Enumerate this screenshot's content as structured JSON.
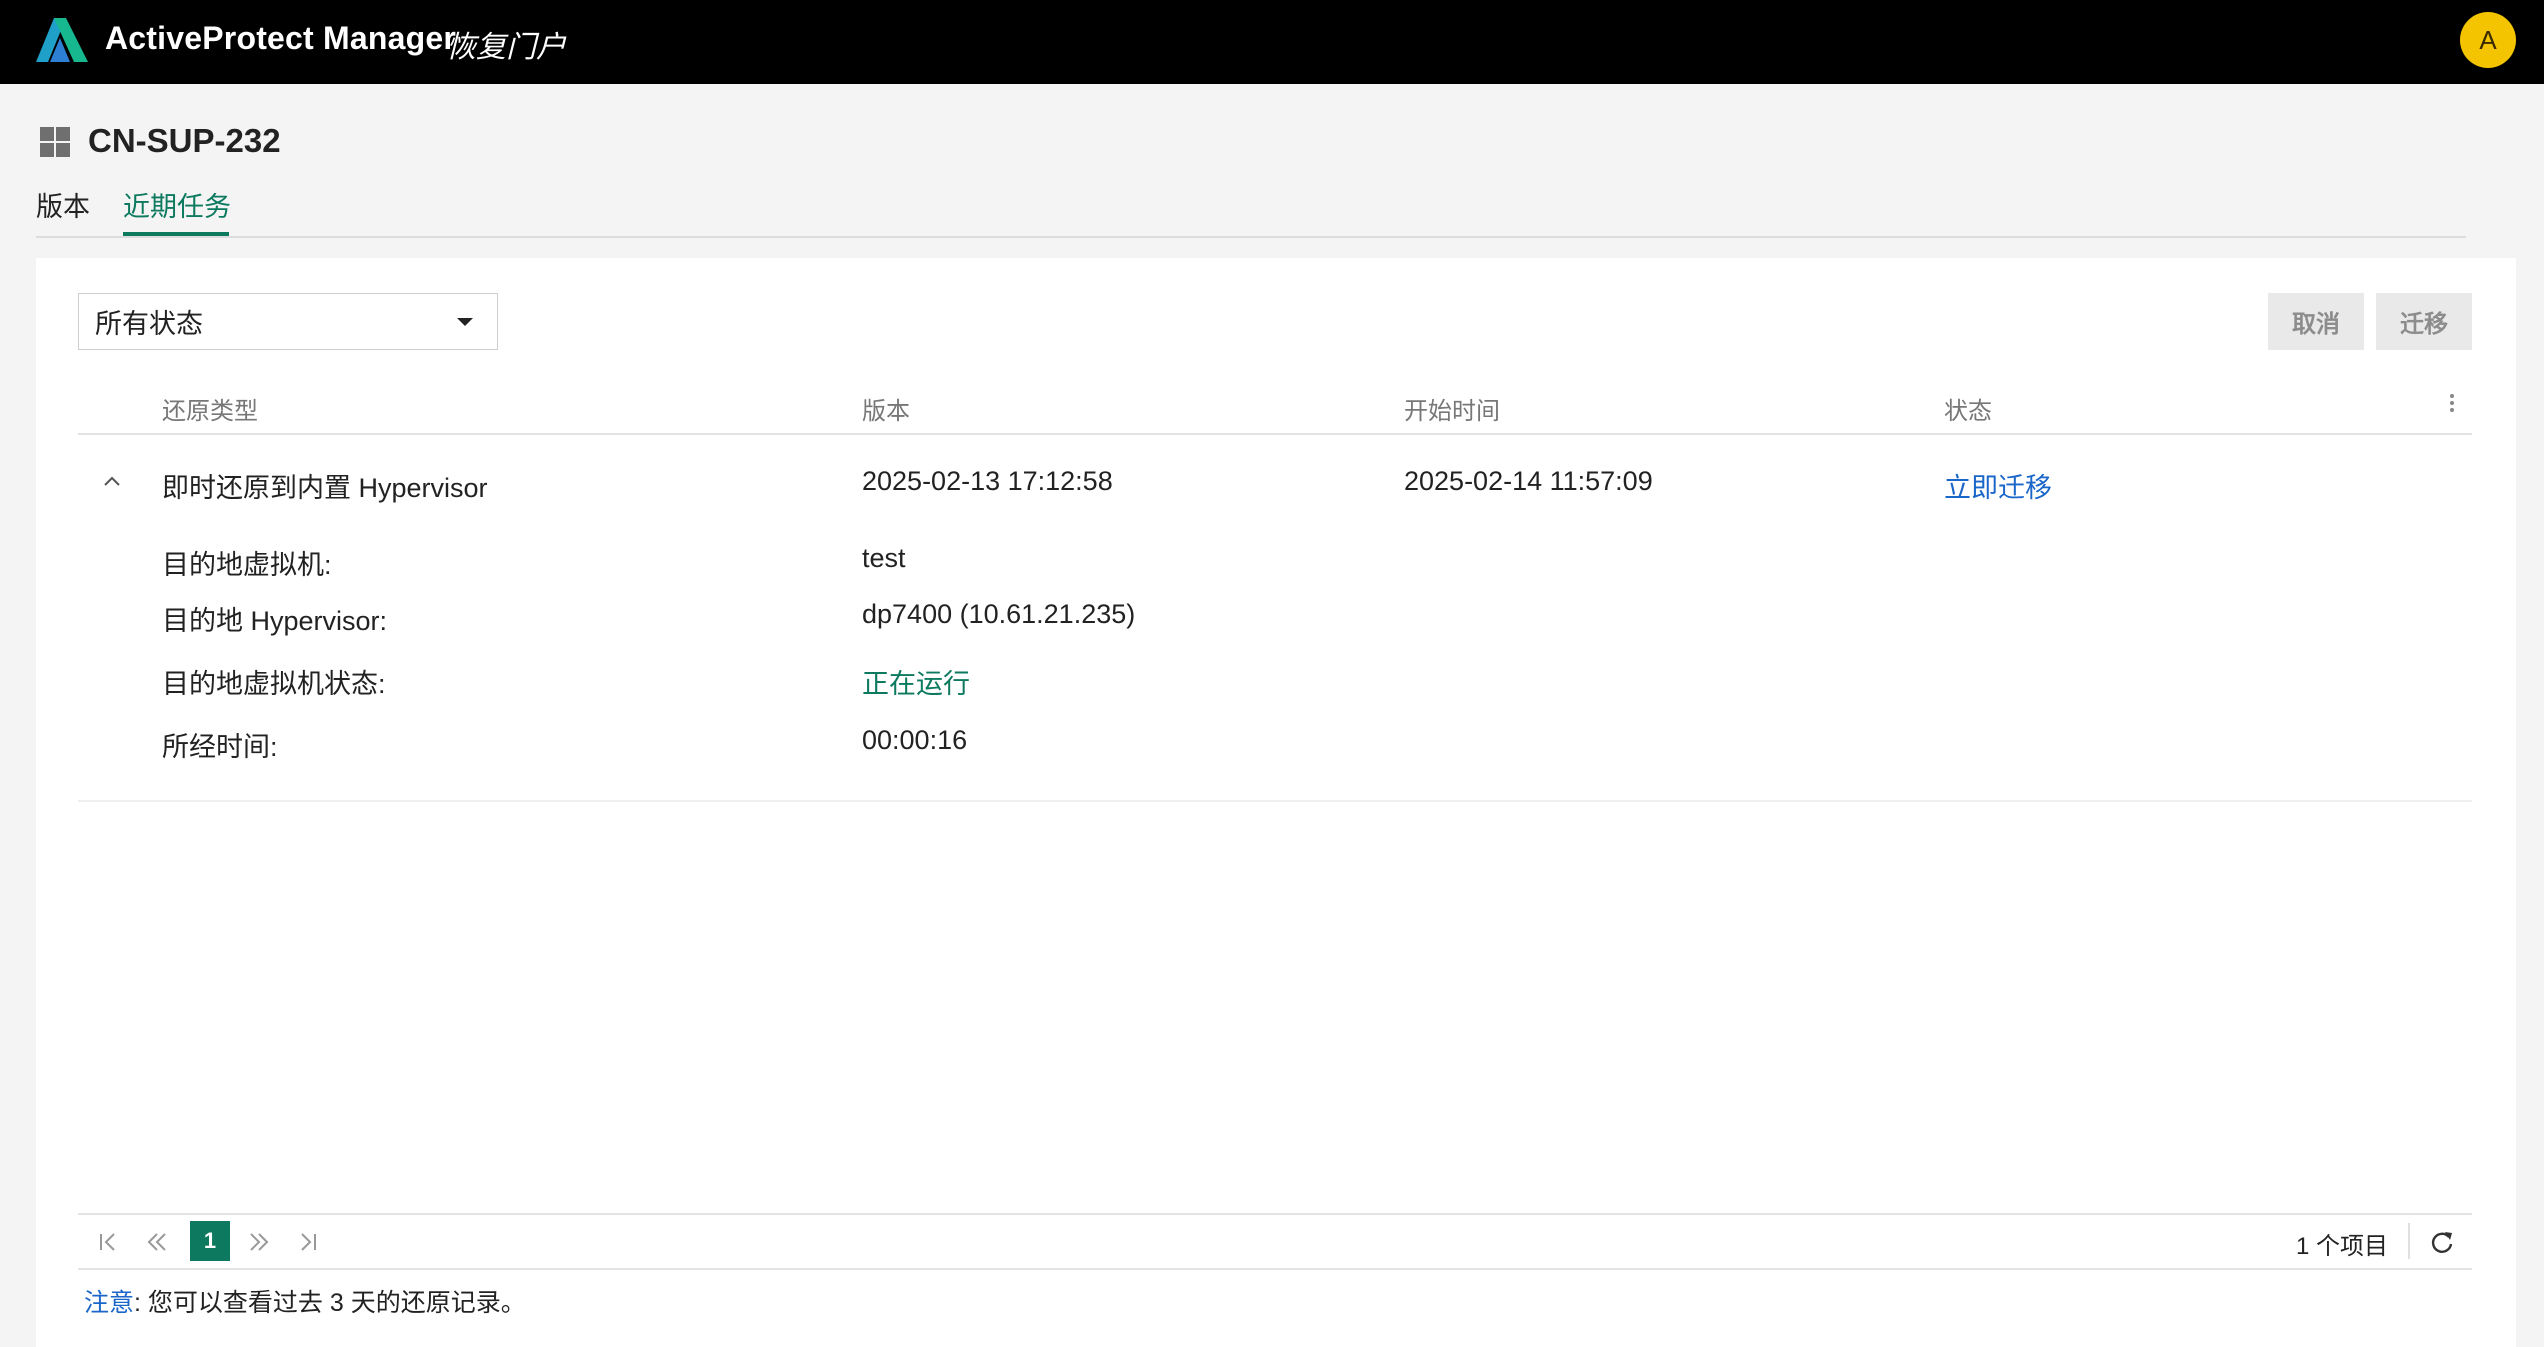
{
  "header": {
    "app_title": "ActiveProtect Manager",
    "app_subtitle": "恢复门户",
    "user_initial": "A"
  },
  "page": {
    "title": "CN-SUP-232"
  },
  "tabs": [
    {
      "label": "版本",
      "active": false
    },
    {
      "label": "近期任务",
      "active": true
    }
  ],
  "toolbar": {
    "filter_value": "所有状态",
    "cancel_label": "取消",
    "migrate_label": "迁移"
  },
  "table": {
    "columns": [
      "还原类型",
      "版本",
      "开始时间",
      "状态"
    ],
    "rows": [
      {
        "restore_type": "即时还原到内置 Hypervisor",
        "version": "2025-02-13 17:12:58",
        "start_time": "2025-02-14 11:57:09",
        "status": "立即迁移",
        "expanded": true,
        "details": [
          {
            "label": "目的地虚拟机:",
            "value": "test"
          },
          {
            "label": "目的地 Hypervisor:",
            "value": "dp7400 (10.61.21.235)"
          },
          {
            "label": "目的地虚拟机状态:",
            "value": "正在运行"
          },
          {
            "label": "所经时间:",
            "value": "00:00:16"
          }
        ]
      }
    ]
  },
  "pagination": {
    "current_page": "1",
    "item_count": "1 个项目"
  },
  "footer_note": {
    "label": "注意",
    "text": ": 您可以查看过去 3 天的还原记录。"
  },
  "colors": {
    "accent_green": "#0d7a5f",
    "link_blue": "#1a66c9",
    "avatar_yellow": "#f5c400",
    "header_black": "#000000"
  },
  "icons": {
    "logo": "activeprotect-logo",
    "page": "grid-icon",
    "filter_caret": "caret-down-icon",
    "row_toggle": "chevron-up-icon",
    "column_menu": "kebab-menu-icon",
    "first": "first-page-icon",
    "prev": "prev-page-icon",
    "next": "next-page-icon",
    "last": "last-page-icon",
    "refresh": "refresh-icon"
  }
}
